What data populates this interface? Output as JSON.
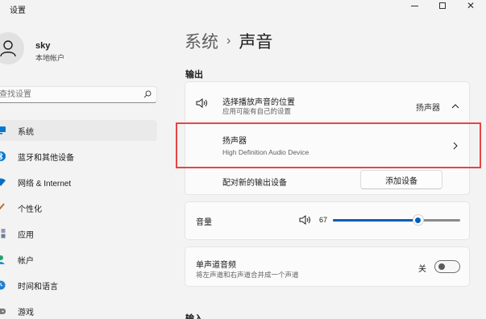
{
  "window": {
    "title": "设置"
  },
  "user": {
    "name": "sky",
    "account_type": "本地帐户"
  },
  "search": {
    "placeholder": "查找设置"
  },
  "nav": {
    "items": [
      {
        "label": "系统",
        "icon": "monitor-icon",
        "active": true
      },
      {
        "label": "蓝牙和其他设备",
        "icon": "bluetooth-icon",
        "active": false
      },
      {
        "label": "网络 & Internet",
        "icon": "wifi-icon",
        "active": false
      },
      {
        "label": "个性化",
        "icon": "brush-icon",
        "active": false
      },
      {
        "label": "应用",
        "icon": "apps-icon",
        "active": false
      },
      {
        "label": "帐户",
        "icon": "person-icon",
        "active": false
      },
      {
        "label": "时间和语言",
        "icon": "globe-clock-icon",
        "active": false
      },
      {
        "label": "游戏",
        "icon": "gamepad-icon",
        "active": false
      }
    ]
  },
  "breadcrumb": {
    "parent": "系统",
    "separator": "›",
    "current": "声音"
  },
  "output": {
    "section_title": "输出",
    "choose_device": {
      "title": "选择播放声音的位置",
      "subtitle": "应用可能有自己的设置",
      "selected": "扬声器",
      "icon": "speaker-icon"
    },
    "device": {
      "name": "扬声器",
      "description": "High Definition Audio Device"
    },
    "pair": {
      "label": "配对新的输出设备",
      "button": "添加设备"
    },
    "volume": {
      "label": "音量",
      "value": 67,
      "icon": "speaker-icon"
    },
    "mono": {
      "title": "单声道音频",
      "subtitle": "将左声道和右声道合并成一个声道",
      "state": "关",
      "on": false
    }
  },
  "input": {
    "section_title": "输入"
  },
  "colors": {
    "accent": "#005fb8",
    "highlight_box": "#e64545"
  }
}
